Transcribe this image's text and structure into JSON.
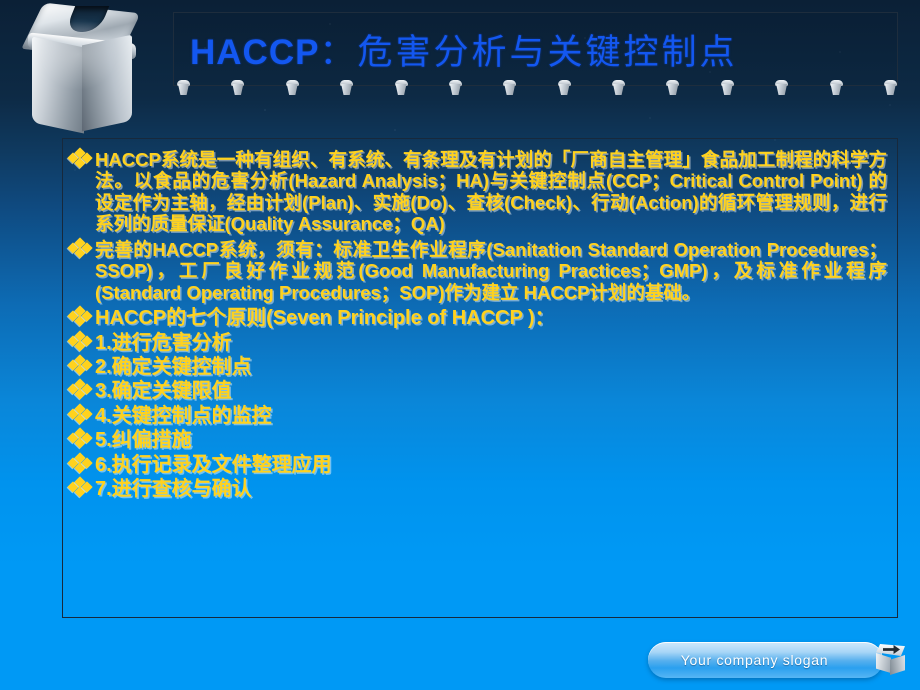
{
  "header": {
    "title_en": "HACCP",
    "title_sep": "：",
    "title_cn": "危害分析与关键控制点",
    "title_color": "#1357f0",
    "logo_icon": "metallic-cube-logo",
    "decor_icon": "mini-cube-icon",
    "decor_count": 14
  },
  "content": {
    "bullets": [
      {
        "glyph": "diamond-cluster-bullet",
        "text": "HACCP系统是一种有组织、有系统、有条理及有计划的「厂商自主管理」食品加工制程的科学方法。以食品的危害分析(Hazard Analysis；HA)与关键控制点(CCP；Critical Control Point) 的设定作为主轴，经由计划(Plan)、实施(Do)、查核(Check)、行动(Action)的循环管理规则，进行系列的质量保证(Quality Assurance；QA)"
      },
      {
        "glyph": "diamond-cluster-bullet",
        "text": "完善的HACCP系统，须有：标准卫生作业程序(Sanitation Standard Operation Procedures；SSOP)，工厂良好作业规范(Good Manufacturing Practices；GMP)，及标准作业程序(Standard Operating Procedures；SOP)作为建立 HACCP计划的基础。"
      },
      {
        "glyph": "diamond-cluster-bullet",
        "text": "HACCP的七个原则(Seven Principle of HACCP )："
      },
      {
        "glyph": "diamond-cluster-bullet",
        "text": "1.进行危害分析"
      },
      {
        "glyph": "diamond-cluster-bullet",
        "text": "2.确定关键控制点"
      },
      {
        "glyph": "diamond-cluster-bullet",
        "text": "3.确定关键限值"
      },
      {
        "glyph": "diamond-cluster-bullet",
        "text": "4.关键控制点的监控"
      },
      {
        "glyph": "diamond-cluster-bullet",
        "text": "5.纠偏措施"
      },
      {
        "glyph": "diamond-cluster-bullet",
        "text": "6.执行记录及文件整理应用"
      },
      {
        "glyph": "diamond-cluster-bullet",
        "text": "7.进行查核与确认"
      }
    ],
    "text_color": "#ffd21e"
  },
  "footer": {
    "slogan": "Your company slogan",
    "icon": "metallic-cube-icon"
  },
  "theme": {
    "background_top": "#0b2036",
    "background_bottom": "#0099f5",
    "border_color": "#17293c"
  }
}
